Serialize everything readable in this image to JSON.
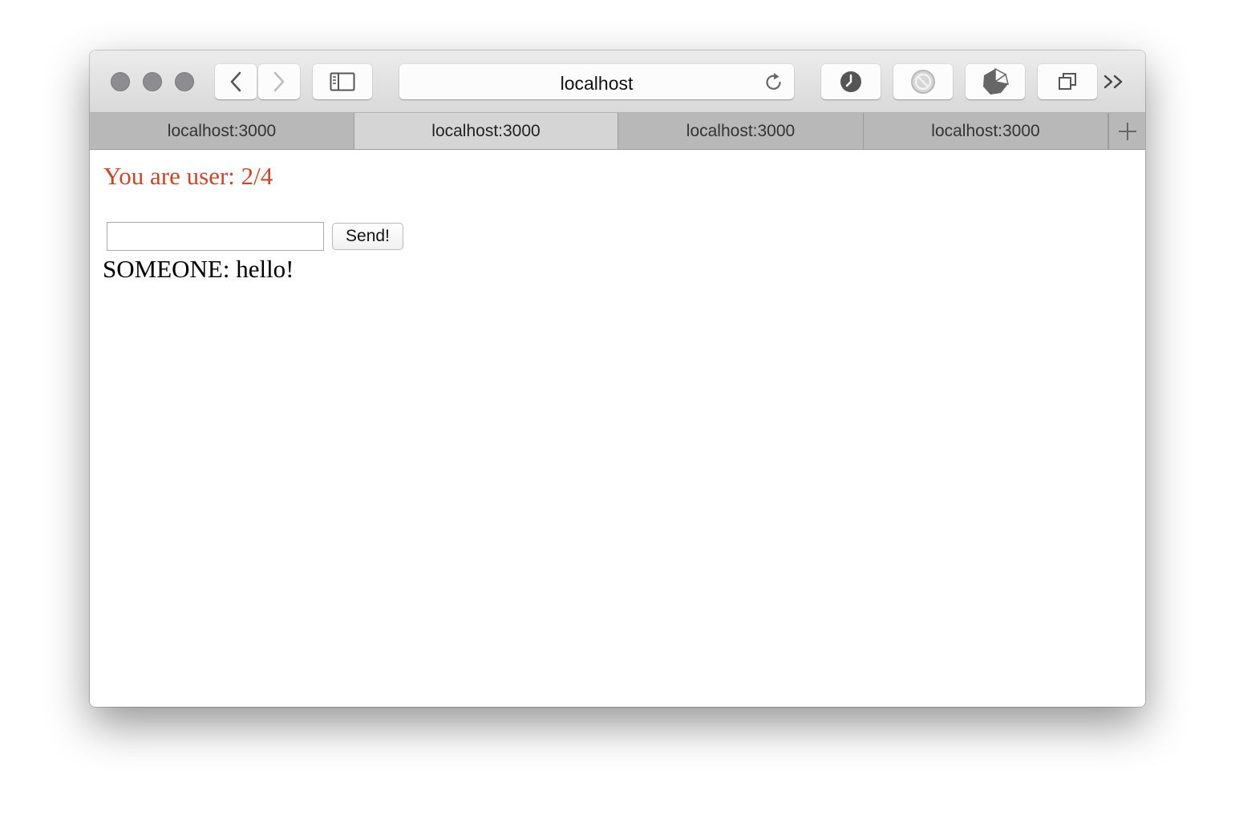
{
  "window_controls": [
    "close",
    "minimize",
    "zoom"
  ],
  "toolbar": {
    "back_icon": "chevron-left-icon",
    "forward_icon": "chevron-right-icon",
    "sidebar_icon": "sidebar-icon",
    "address": "localhost",
    "reload_icon": "reload-icon",
    "extensions": [
      "clock-icon",
      "block-icon",
      "pie-icon",
      "tabs-overview-icon"
    ],
    "overflow_label": ">>"
  },
  "tabs": [
    {
      "label": "localhost:3000",
      "active": false
    },
    {
      "label": "localhost:3000",
      "active": true
    },
    {
      "label": "localhost:3000",
      "active": false
    },
    {
      "label": "localhost:3000",
      "active": false
    }
  ],
  "new_tab_icon": "plus-icon",
  "page": {
    "user_text": "You are user: 2/4",
    "input_value": "",
    "send_label": "Send!",
    "messages": [
      "SOMEONE: hello!"
    ]
  },
  "colors": {
    "accent_text": "#c8472b"
  }
}
